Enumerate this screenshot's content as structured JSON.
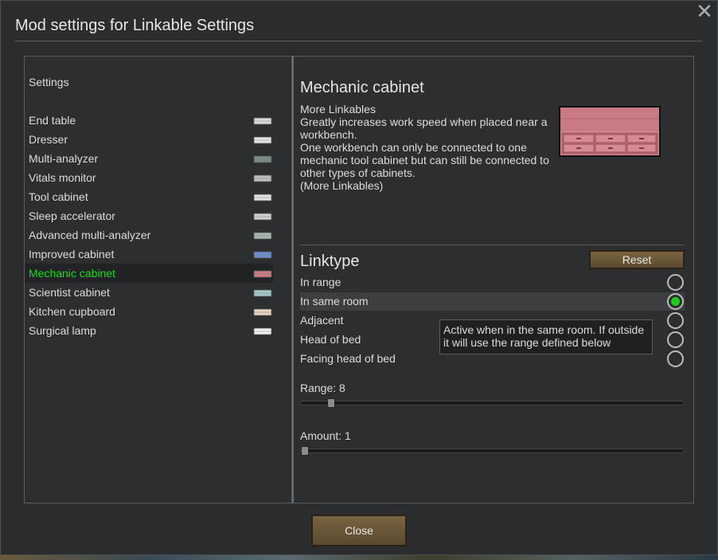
{
  "window": {
    "title": "Mod settings for Linkable Settings",
    "close_icon": "close-icon"
  },
  "left": {
    "heading": "Settings",
    "items": [
      {
        "label": "End table",
        "icon": "end-table-icon",
        "color": "#d9d9d9"
      },
      {
        "label": "Dresser",
        "icon": "dresser-icon",
        "color": "#e3e3e3"
      },
      {
        "label": "Multi-analyzer",
        "icon": "multi-analyzer-icon",
        "color": "#7a8a80"
      },
      {
        "label": "Vitals monitor",
        "icon": "vitals-monitor-icon",
        "color": "#bdbdbd"
      },
      {
        "label": "Tool cabinet",
        "icon": "tool-cabinet-icon",
        "color": "#e0e0e0"
      },
      {
        "label": "Sleep accelerator",
        "icon": "sleep-accelerator-icon",
        "color": "#cfcfcf"
      },
      {
        "label": "Advanced multi-analyzer",
        "icon": "advanced-multi-analyzer-icon",
        "color": "#a9b5ae"
      },
      {
        "label": "Improved cabinet",
        "icon": "improved-cabinet-icon",
        "color": "#6b8bc9"
      },
      {
        "label": "Mechanic cabinet",
        "icon": "mechanic-cabinet-icon",
        "color": "#c97a82"
      },
      {
        "label": "Scientist cabinet",
        "icon": "scientist-cabinet-icon",
        "color": "#9fc7c7"
      },
      {
        "label": "Kitchen cupboard",
        "icon": "kitchen-cupboard-icon",
        "color": "#e8d2c0"
      },
      {
        "label": "Surgical lamp",
        "icon": "surgical-lamp-icon",
        "color": "#f0f0f0"
      }
    ],
    "selected_color": "#1ddb1d"
  },
  "right": {
    "name": "Mechanic cabinet",
    "desc_lines": [
      "More Linkables",
      "Greatly increases work speed when placed near a workbench.",
      "One workbench can only be connected to one mechanic tool cabinet but can still be connected to other types of cabinets.",
      "(More Linkables)"
    ],
    "linktype_title": "Linktype",
    "reset_label": "Reset",
    "options": [
      {
        "label": "In range",
        "checked": false
      },
      {
        "label": "In same room",
        "checked": true
      },
      {
        "label": "Adjacent",
        "checked": false
      },
      {
        "label": "Head of bed",
        "checked": false
      },
      {
        "label": "Facing head of bed",
        "checked": false
      }
    ],
    "tooltip": "Active when in the same room. If outside it will use the range defined below",
    "range_label": "Range: 8",
    "range_value": 8,
    "range_min": 1,
    "range_max": 100,
    "amount_label": "Amount: 1",
    "amount_value": 1,
    "amount_min": 1,
    "amount_max": 100
  },
  "footer": {
    "close_label": "Close"
  }
}
